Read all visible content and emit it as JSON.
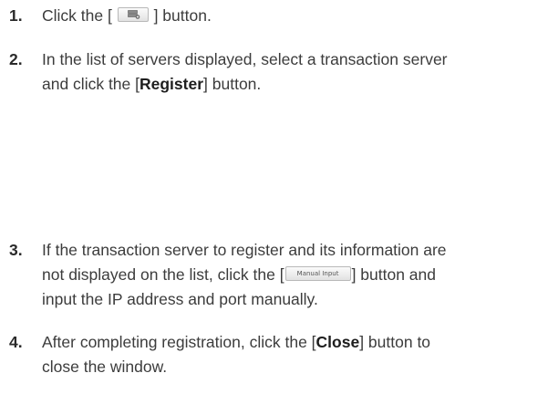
{
  "steps": [
    {
      "number": "1.",
      "pre": "Click the [",
      "button_icon": "server-add-icon",
      "post": "] button."
    },
    {
      "number": "2.",
      "line1": "In the list of servers displayed, select a transaction server",
      "line2_pre": "and click the [",
      "bold": "Register",
      "line2_post": "] button."
    },
    {
      "number": "3.",
      "line1": "If the transaction server to register and its information are",
      "line2_pre": "not displayed on the list, click the [",
      "button_label": "Manual Input",
      "line2_post": "] button and",
      "line3": "input the IP address and port manually."
    },
    {
      "number": "4.",
      "line1_pre": "After completing registration, click the [",
      "bold": "Close",
      "line1_post": "] button to",
      "line2": "close the window."
    }
  ]
}
